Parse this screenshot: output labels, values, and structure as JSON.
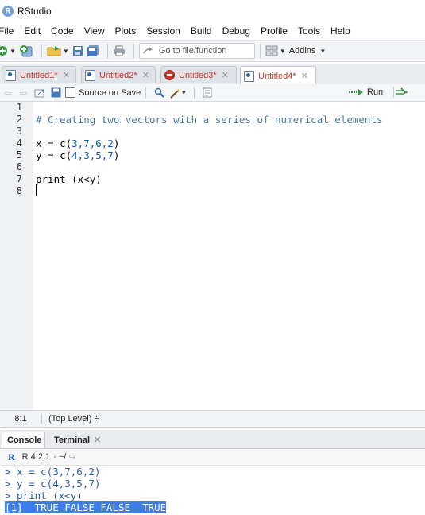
{
  "window": {
    "title": "RStudio",
    "logo_letter": "R"
  },
  "menu": [
    "File",
    "Edit",
    "Code",
    "View",
    "Plots",
    "Session",
    "Build",
    "Debug",
    "Profile",
    "Tools",
    "Help"
  ],
  "toolbar": {
    "goto_placeholder": "Go to file/function",
    "addins_label": "Addins"
  },
  "tabs": [
    {
      "label": "Untitled1*",
      "icon": "r-file-icon"
    },
    {
      "label": "Untitled2*",
      "icon": "r-file-icon"
    },
    {
      "label": "Untitled3*",
      "icon": "stop-icon"
    },
    {
      "label": "Untitled4*",
      "icon": "r-file-icon",
      "active": true
    }
  ],
  "editor_toolbar": {
    "source_on_save": "Source on Save",
    "run_label": "Run"
  },
  "editor": {
    "line_numbers": [
      "1",
      "2",
      "3",
      "4",
      "5",
      "6",
      "7",
      "8"
    ],
    "comment": "# Creating two vectors with a series of numerical elements",
    "x_prefix": "x = c(",
    "x_values": "3,7,6,2",
    "y_prefix": "y = c(",
    "y_values": "4,3,5,7",
    "close_paren": ")",
    "print_line": "print (x<y)"
  },
  "status_bar": {
    "cursor_position": "8:1",
    "scope": "(Top Level) ÷"
  },
  "console": {
    "tabs": [
      "Console",
      "Terminal"
    ],
    "r_version": "R 4.2.1",
    "working_dir": "· ~/",
    "lines": [
      "> x = c(3,7,6,2)",
      "> y = c(4,3,5,7)",
      "> print (x<y)"
    ],
    "output": "[1]  TRUE FALSE FALSE  TRUE"
  },
  "colors": {
    "tab_text": "#c0392b",
    "selection": "#3d7ee8",
    "code_comment": "#4c7a9a"
  }
}
